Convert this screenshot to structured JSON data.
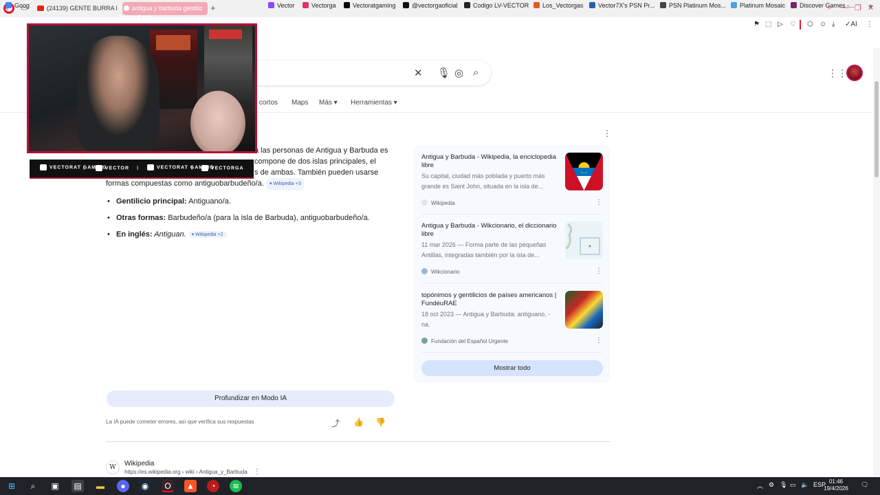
{
  "browser": {
    "tabs": [
      {
        "label": "(24139) GENTE BURRA EN"
      },
      {
        "label": "antigua y barbuda gentilic"
      }
    ],
    "bookmarks": [
      "Goog",
      "Vector",
      "Vectorga",
      "Vectoratgaming",
      "@vectorgaoficial",
      "Codigo LV-VECTOR",
      "Los_Vectorgas",
      "Vector7X's PSN Pr...",
      "PSN Platinum Mos...",
      "Platinum Mosaic",
      "Discover Games -..."
    ],
    "toolbar_label_ai": "AI"
  },
  "overlay": {
    "cam_logo": "Vector",
    "socials": [
      "VECTORAT GAMING",
      "VECTOR",
      "VECTORAT GAMING",
      "VECTORGA"
    ]
  },
  "search": {
    "filters": [
      "s cortos",
      "Maps",
      "Más",
      "Herramientas"
    ]
  },
  "ai_overview": {
    "line1": "a las personas de Antigua y Barbuda es",
    "line2": "compone de dos islas principales, el",
    "line3": "s de ambas. También pueden usarse",
    "line4": "formas compuestas como antiguobarbudeño/a.",
    "chip1": "Wikipedia +3",
    "bullets": [
      {
        "label": "Gentilicio principal:",
        "text": " Antiguano/a."
      },
      {
        "label": "Otras formas:",
        "text": " Barbudeño/a (para la isla de Barbuda), antiguobarbudeño/a."
      },
      {
        "label": "En inglés:",
        "text": " Antiguan.",
        "chip": "Wikipedia +2"
      }
    ],
    "deep_dive": "Profundizar en Modo IA",
    "disclaimer": "La IA puede cometer errores, así que verifica sus respuestas"
  },
  "sources": [
    {
      "title": "Antigua y Barbuda - Wikipedia, la enciclopedia libre",
      "snippet": "Su capital, ciudad más poblada y puerto más grande es Saint John, situada en la isla de...",
      "site": "Wikipedia"
    },
    {
      "title": "Antigua y Barbuda - Wikcionario, el diccionario libre",
      "snippet": "11 mar 2026 — Forma parte de las pequeñas Antillas, integradas también por la isla de...",
      "site": "Wikcionario"
    },
    {
      "title": "topónimos y gentilicios de países americanos | FundéuRAE",
      "snippet": "18 oct 2023 — Antigua y Barbuda: antiguano, -na.",
      "site": "Fundación del Español Urgente"
    }
  ],
  "show_all": "Mostrar todo",
  "result": {
    "site": "Wikipedia",
    "url": "https://es.wikipedia.org › wiki › Antigua_y_Barbuda"
  },
  "taskbar": {
    "lang": "ESP",
    "time": "01:46",
    "date": "19/4/2026"
  }
}
